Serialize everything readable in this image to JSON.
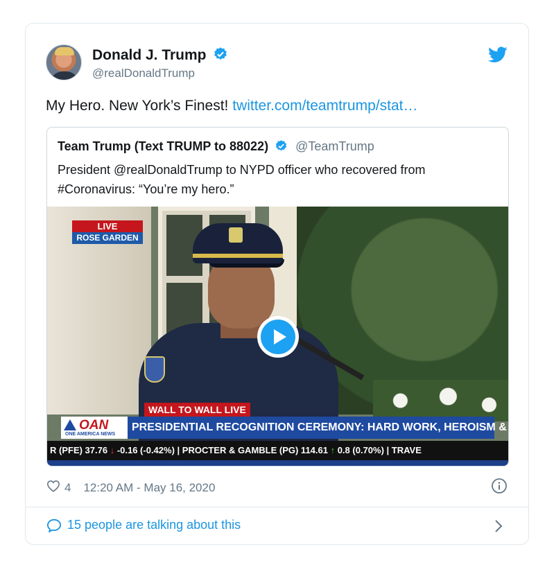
{
  "author": {
    "name": "Donald J. Trump",
    "handle": "@realDonaldTrump"
  },
  "tweet": {
    "text": "My Hero. New York’s Finest! ",
    "link": "twitter.com/teamtrump/stat…"
  },
  "quote": {
    "name": "Team Trump (Text TRUMP to 88022)",
    "handle": "@TeamTrump",
    "text": "President @realDonaldTrump to NYPD officer who recovered from #Coronavirus: “You’re my hero.”"
  },
  "video": {
    "live_label": "LIVE",
    "location_label": "ROSE GARDEN",
    "wall_label": "WALL TO WALL LIVE",
    "network_logo": "OAN",
    "network_sub": "ONE AMERICA NEWS",
    "headline": "PRESIDENTIAL RECOGNITION CEREMONY: HARD WORK, HEROISM & HOPE",
    "ticker": {
      "t1": "R (PFE)  37.76 ",
      "t1_arrow": "↓",
      "t1b": " -0.16 (-0.42%)  |  PROCTER & GAMBLE (PG)  114.61 ",
      "t2_arrow": "↑",
      "t2": " 0.8 (0.70%)  |  TRAVE"
    }
  },
  "meta": {
    "likes": "4",
    "timestamp": "12:20 AM - May 16, 2020"
  },
  "footer": {
    "talking": "15 people are talking about this"
  },
  "colors": {
    "link": "#1b95e0",
    "verified": "#1da1f2",
    "muted": "#657786"
  }
}
